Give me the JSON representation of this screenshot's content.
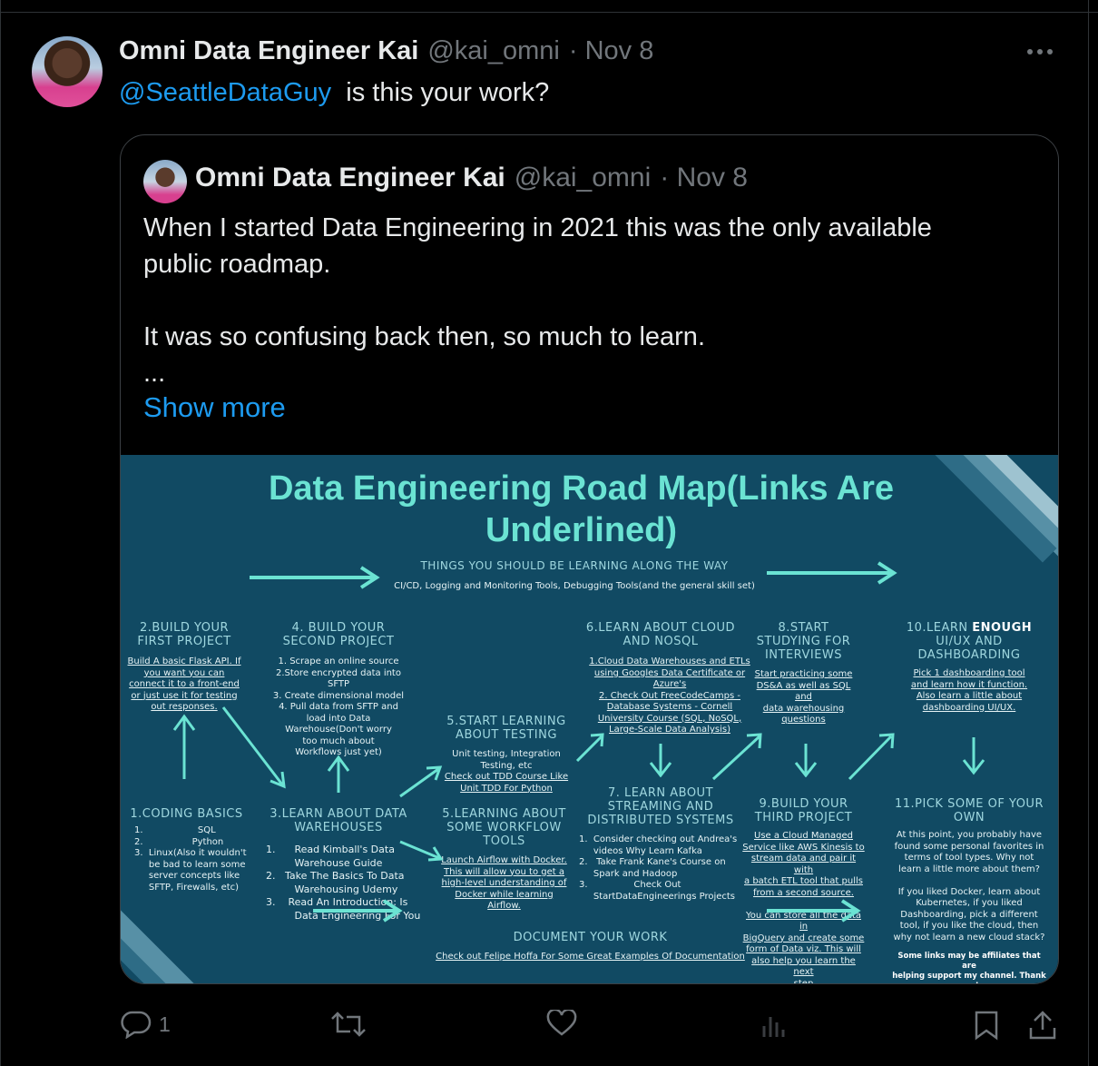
{
  "tweet": {
    "author_name": "Omni Data Engineer Kai",
    "author_handle": "@kai_omni",
    "date": "· Nov 8",
    "mention": "@SeattleDataGuy",
    "text": "is this your work?"
  },
  "quoted": {
    "author_name": "Omni Data Engineer Kai",
    "author_handle": "@kai_omni",
    "date": "· Nov 8",
    "line1": "When I started Data Engineering in 2021 this was the only available",
    "line2": "public roadmap.",
    "line3": "It was so confusing back then, so much to learn.",
    "ellipsis": "...",
    "show_more": "Show more"
  },
  "roadmap": {
    "title_line1": "Data Engineering Road Map(Links Are",
    "title_line2": "Underlined)",
    "along_way_heading": "THINGS YOU SHOULD BE LEARNING ALONG THE WAY",
    "along_way_text": "CI/CD, Logging and Monitoring Tools, Debugging Tools(and the general skill set)",
    "s2_title": "2.BUILD YOUR\nFIRST PROJECT",
    "s2_text": "Build A basic Flask API. If\nyou want you can\nconnect it to a front-end\nor just use it for testing\nout responses.",
    "s4_title": "4. BUILD YOUR\nSECOND PROJECT",
    "s4_text": "1. Scrape an online source\n2.Store encrypted data into\nSFTP\n3. Create dimensional model\n4. Pull data from SFTP  and\nload into Data\nWarehouse(Don't worry\ntoo much about\nWorkflows just yet)",
    "s5_title": "5.START LEARNING\nABOUT TESTING",
    "s5_text": "Unit testing, Integration\nTesting, etc",
    "s5_link": "Check out TDD Course Like\nUnit TDD For Python",
    "s6_title": "6.LEARN ABOUT CLOUD\nAND NOSQL",
    "s6_text": "1.Cloud Data Warehouses and ETLs\nusing Googles Data Certificate or\nAzure's\n2.     Check Out FreeCodeCamps -\nDatabase Systems - Cornell\nUniversity Course (SQL, NoSQL,\nLarge-Scale Data Analysis)",
    "s8_title": "8.START\nSTUDYING FOR\nINTERVIEWS",
    "s8_text": "Start practicing some\nDS&A as well as SQL and\ndata warehousing\nquestions",
    "s10_title_a": "10.LEARN ",
    "s10_title_b": "ENOUGH",
    "s10_title_c": "\nUI/UX AND\nDASHBOARDING",
    "s10_text": "Pick 1 dashboarding tool\nand learn how it function.\nAlso learn a little about\ndashboarding UI/UX.",
    "s1_title": "1.CODING BASICS",
    "s1_text": "1.                   SQL\n2.                 Python\n3.  Linux(Also it wouldn't\n     be bad to learn some\n     server concepts like\n     SFTP, Firewalls, etc)",
    "s3_title": "3.LEARN ABOUT DATA\nWAREHOUSES",
    "s3_text": "1.      Read Kimball's Data\n         Warehouse Guide\n2.   Take The Basics To Data\n         Warehousing Udemy\n3.    Read An Introduction: Is\n         Data Engineering For You",
    "s5b_title": "5.LEARNING ABOUT\nSOME WORKFLOW\nTOOLS",
    "s5b_text": "Launch Airflow with Docker.\nThis will allow you to get a\nhigh-level understanding of\nDocker while learning\nAirflow.",
    "s7_title": "7. LEARN ABOUT\nSTREAMING AND\nDISTRIBUTED SYSTEMS",
    "s7_text": "1.  Consider checking out Andrea's\n     videos Why Learn Kafka\n2.   Take Frank Kane's Course on\n     Spark and Hadoop\n3.                Check Out\n     StartDataEngineerings Projects",
    "s9_title": "9.BUILD YOUR\nTHIRD PROJECT",
    "s9_text": "Use a Cloud Managed\nService like AWS Kinesis to\nstream data and pair it with\na batch ETL tool that pulls\nfrom a second source.\n\nYou can store all the data in\nBigQuery and create some\nform of Data viz. This will\nalso help you learn the next\nstep",
    "s11_title": "11.PICK SOME OF YOUR\nOWN",
    "s11_text": "At this point, you probably have\nfound some personal favorites in\nterms of tool types. Why not\nlearn a little more about them?\n\nIf you liked Docker, learn about\nKubernetes, if you liked\nDashboarding, pick a different\ntool, if you like the cloud, then\nwhy not learn a new cloud stack?",
    "footer_note": "Some links may be affiliates that are\nhelping support my channel. Thank you!",
    "document_heading": "DOCUMENT YOUR WORK",
    "document_text": "Check out Felipe Hoffa For Some Great Examples Of Documentation"
  },
  "actions": {
    "reply_count": "1"
  },
  "colors": {
    "accent": "#1d9bf0",
    "roadmap_bg": "#114a63",
    "roadmap_accent": "#6be3d3"
  }
}
